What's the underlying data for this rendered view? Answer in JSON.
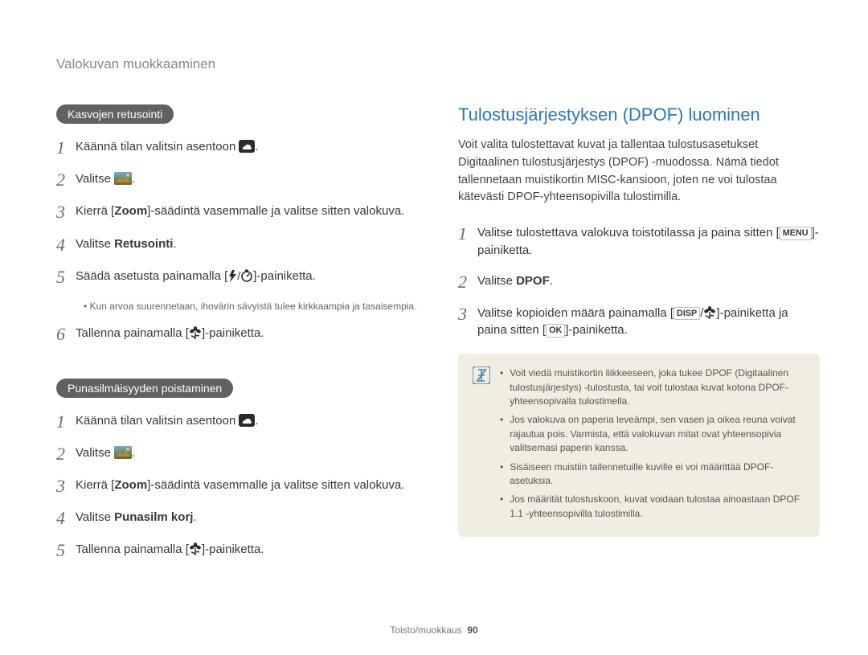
{
  "page_header": "Valokuvan muokkaaminen",
  "left": {
    "section1": {
      "pill": "Kasvojen retusointi",
      "steps": [
        {
          "num": "1",
          "pre": "Käännä tilan valitsin asentoon ",
          "icon": "camera-cloud",
          "post": "."
        },
        {
          "num": "2",
          "pre": "Valitse ",
          "icon": "retouch-thumb",
          "post": "."
        },
        {
          "num": "3",
          "pre": "Kierrä [",
          "bold": "Zoom",
          "post": "]-säädintä vasemmalle ja valitse sitten valokuva."
        },
        {
          "num": "4",
          "pre": "Valitse ",
          "bold": "Retusointi",
          "post": "."
        },
        {
          "num": "5",
          "pre": "Säädä asetusta painamalla [",
          "icon": "flash-timer-pair",
          "post": "]-painiketta."
        },
        {
          "num": "6",
          "pre": "Tallenna painamalla [",
          "icon": "macro-flower",
          "post": "]-painiketta."
        }
      ],
      "note": "Kun arvoa suurennetaan, ihovärin sävyistä tulee kirkkaampia ja tasaisempia."
    },
    "section2": {
      "pill": "Punasilmäisyyden poistaminen",
      "steps": [
        {
          "num": "1",
          "pre": "Käännä tilan valitsin asentoon ",
          "icon": "camera-cloud",
          "post": "."
        },
        {
          "num": "2",
          "pre": "Valitse ",
          "icon": "retouch-thumb",
          "post": "."
        },
        {
          "num": "3",
          "pre": "Kierrä [",
          "bold": "Zoom",
          "post": "]-säädintä vasemmalle ja valitse sitten valokuva."
        },
        {
          "num": "4",
          "pre": "Valitse ",
          "bold": "Punasilm korj",
          "post": "."
        },
        {
          "num": "5",
          "pre": "Tallenna painamalla [",
          "icon": "macro-flower",
          "post": "]-painiketta."
        }
      ]
    }
  },
  "right": {
    "title": "Tulostusjärjestyksen (DPOF) luominen",
    "intro": "Voit valita tulostettavat kuvat ja tallentaa tulostusasetukset Digitaalinen tulostusjärjestys (DPOF) -muodossa. Nämä tiedot tallennetaan muistikortin MISC-kansioon, joten ne voi tulostaa kätevästi DPOF-yhteensopivilla tulostimilla.",
    "steps": [
      {
        "num": "1",
        "pre": "Valitse tulostettava valokuva toistotilassa ja paina sitten [",
        "kbd": "MENU",
        "post": "]-painiketta."
      },
      {
        "num": "2",
        "pre": "Valitse ",
        "bold": "DPOF",
        "post": "."
      },
      {
        "num": "3",
        "pre": "Valitse kopioiden määrä painamalla [",
        "kbd": "DISP",
        "mid": "/",
        "icon": "macro-flower",
        "post": "]-painiketta ja paina sitten [",
        "kbd2": "OK",
        "post2": "]-painiketta."
      }
    ],
    "info": [
      "Voit viedä muistikortin liikkeeseen, joka tukee DPOF (Digitaalinen tulostusjärjestys) -tulostusta, tai voit tulostaa kuvat kotona DPOF-yhteensopivalla tulostimella.",
      "Jos valokuva on paperia leveämpi, sen vasen ja oikea reuna voivat rajautua pois. Varmista, että valokuvan mitat ovat yhteensopivia valitsemasi paperin kanssa.",
      "Sisäiseen muistiin tallennetuille kuville ei voi määrittää DPOF-asetuksia.",
      "Jos määrität tulostuskoon, kuvat voidaan tulostaa ainoastaan DPOF 1.1 -yhteensopivilla tulostimilla."
    ]
  },
  "footer": {
    "label": "Toisto/muokkaus",
    "page": "90"
  }
}
